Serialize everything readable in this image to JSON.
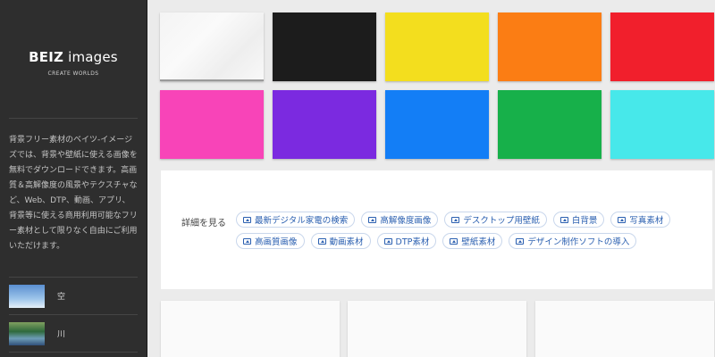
{
  "sidebar": {
    "brand_bold": "BEIZ",
    "brand_light": "images",
    "tagline": "CREATE WORLDS",
    "intro": "背景フリー素材のベイツ-イメージズでは、背景や壁紙に使える画像を無料でダウンロードできます。高画質＆高解像度の風景やテクスチャなど、Web、DTP、動画、アプリ、背景等に使える商用利用可能なフリー素材として限りなく自由にご利用いただけます。",
    "categories": [
      {
        "label": "空",
        "thumb": "sky"
      },
      {
        "label": "川",
        "thumb": "river"
      }
    ]
  },
  "swatches": [
    {
      "color": "#f5f5f5",
      "name": "white"
    },
    {
      "color": "#1c1c1c",
      "name": "black"
    },
    {
      "color": "#f3de1e",
      "name": "yellow"
    },
    {
      "color": "#fb7d14",
      "name": "orange"
    },
    {
      "color": "#f11f2c",
      "name": "red"
    },
    {
      "color": "#f844b8",
      "name": "pink"
    },
    {
      "color": "#7b2ae0",
      "name": "purple"
    },
    {
      "color": "#137ef6",
      "name": "blue"
    },
    {
      "color": "#17b04a",
      "name": "green"
    },
    {
      "color": "#47e8ea",
      "name": "cyan"
    }
  ],
  "tags": {
    "heading": "詳細を見る",
    "row1": [
      "最新デジタル家電の検索",
      "高解像度画像",
      "デスクトップ用壁紙",
      "白背景",
      "写真素材"
    ],
    "row2": [
      "高画質画像",
      "動画素材",
      "DTP素材",
      "壁紙素材",
      "デザイン制作ソフトの導入"
    ]
  }
}
